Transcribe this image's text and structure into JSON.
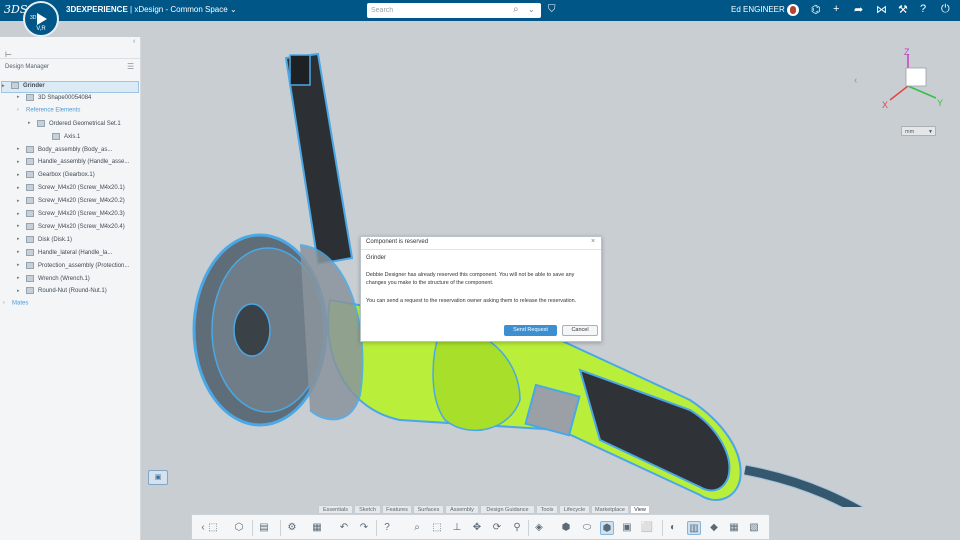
{
  "topbar": {
    "brand": "3DS",
    "compass_version": "V,R",
    "compass_3d": "3D",
    "app_name": "3DEXPERIENCE",
    "separator": " | ",
    "app_subtitle": "xDesign - Common Space",
    "search_placeholder": "Search",
    "user_name": "Ed ENGINEER"
  },
  "design_manager": {
    "title": "Design Manager",
    "tree": [
      {
        "label": "Grinder",
        "level": 0,
        "kind": "root"
      },
      {
        "label": "3D Shape00054084",
        "level": 1,
        "kind": "shape"
      },
      {
        "label": "Reference Elements",
        "level": 1,
        "kind": "link"
      },
      {
        "label": "Ordered Geometrical Set.1",
        "level": 2,
        "kind": "geoset"
      },
      {
        "label": "Axis.1",
        "level": 3,
        "kind": "axis"
      },
      {
        "label": "Body_assembly (Body_as...",
        "level": 1,
        "kind": "part"
      },
      {
        "label": "Handle_assembly (Handle_asse...",
        "level": 1,
        "kind": "part"
      },
      {
        "label": "Gearbox (Gearbox.1)",
        "level": 1,
        "kind": "part"
      },
      {
        "label": "Screw_M4x20 (Screw_M4x20.1)",
        "level": 1,
        "kind": "part"
      },
      {
        "label": "Screw_M4x20 (Screw_M4x20.2)",
        "level": 1,
        "kind": "part"
      },
      {
        "label": "Screw_M4x20 (Screw_M4x20.3)",
        "level": 1,
        "kind": "part"
      },
      {
        "label": "Screw_M4x20 (Screw_M4x20.4)",
        "level": 1,
        "kind": "part"
      },
      {
        "label": "Disk (Disk.1)",
        "level": 1,
        "kind": "part"
      },
      {
        "label": "Handle_lateral (Handle_la...",
        "level": 1,
        "kind": "part"
      },
      {
        "label": "Protection_assembly (Protection...",
        "level": 1,
        "kind": "part"
      },
      {
        "label": "Wrench (Wrench.1)",
        "level": 1,
        "kind": "part"
      },
      {
        "label": "Round-Nut (Round-Nut.1)",
        "level": 1,
        "kind": "part"
      },
      {
        "label": "Mates",
        "level": 0,
        "kind": "link"
      }
    ]
  },
  "dialog": {
    "title": "Component is reserved",
    "component": "Grinder",
    "message1": "Debbie Designer has already reserved this component. You will not be able to save any changes you make to the structure of the component.",
    "message2": "You can send a request to the reservation owner asking them to release the reservation.",
    "primary_button": "Send Request",
    "secondary_button": "Cancel"
  },
  "compass_axes": {
    "x": "X",
    "y": "Y",
    "z": "Z"
  },
  "view_select": {
    "value": "mm"
  },
  "action_bar": {
    "tabs": [
      "Essentials",
      "Sketch",
      "Features",
      "Surfaces",
      "Assembly",
      "Design Guidance",
      "Tools",
      "Lifecycle",
      "Marketplace",
      "View"
    ],
    "active_tab": "View"
  },
  "colors": {
    "topbar": "#005686",
    "selection_blue": "#4aa8e6",
    "grinder_green": "#b9ef3a",
    "panel_bg": "#f4f5f6",
    "viewport_bg": "#c9ced3",
    "primary_button": "#3c8fd0"
  }
}
